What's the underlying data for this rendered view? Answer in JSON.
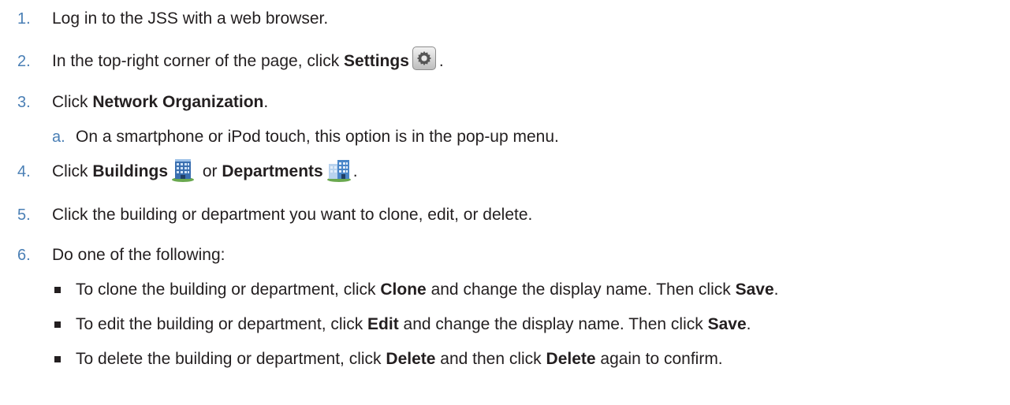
{
  "steps": [
    {
      "num": "1.",
      "text": "Log in to the JSS with a web browser."
    },
    {
      "num": "2.",
      "pre": "In the top-right corner of the page, click ",
      "bold": "Settings",
      "post": "."
    },
    {
      "num": "3.",
      "pre": "Click ",
      "bold": "Network Organization",
      "post": "."
    },
    {
      "num": "a.",
      "text": "On a smartphone or iPod touch, this option is in the pop-up menu."
    },
    {
      "num": "4.",
      "pre": "Click ",
      "bold1": "Buildings",
      "mid": " or ",
      "bold2": "Departments",
      "post": "."
    },
    {
      "num": "5.",
      "text": "Click the building or department you want to clone, edit, or delete."
    },
    {
      "num": "6.",
      "text": "Do one of the following:"
    }
  ],
  "bullets": [
    {
      "pre": "To clone the building or department, click ",
      "bold1": "Clone",
      "mid": " and change the display name. Then click ",
      "bold2": "Save",
      "post": "."
    },
    {
      "pre": "To edit the building or department, click ",
      "bold1": "Edit",
      "mid": " and change the display name. Then click ",
      "bold2": "Save",
      "post": "."
    },
    {
      "pre": "To delete the building or department, click ",
      "bold1": "Delete",
      "mid": " and then click ",
      "bold2": "Delete",
      "post": " again to confirm."
    }
  ],
  "icons": {
    "settings": "gear-icon",
    "buildings": "building-icon",
    "departments": "department-building-icon"
  },
  "colors": {
    "number": "#4a7fb5",
    "text": "#231f20"
  }
}
